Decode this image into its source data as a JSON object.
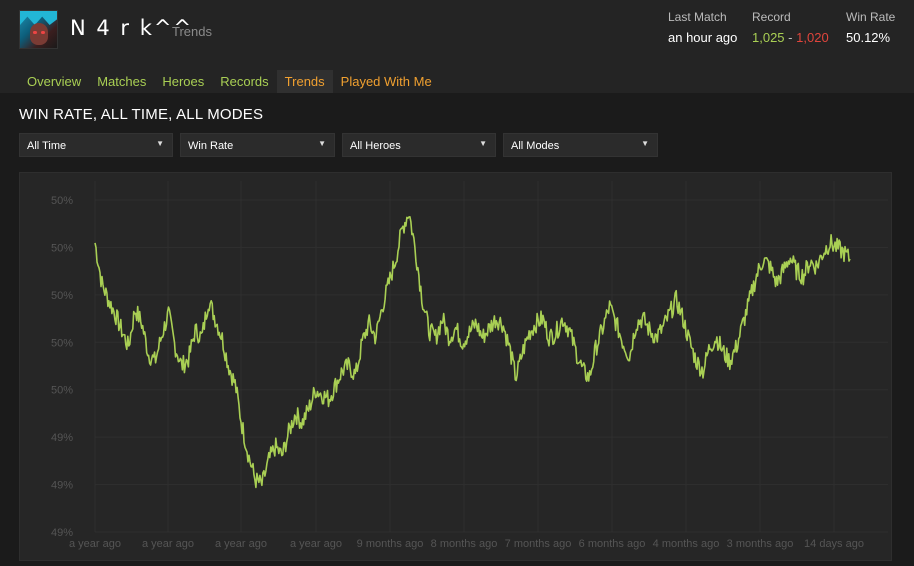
{
  "header": {
    "player_name": "N 4 r k^^",
    "page_subtitle": "Trends",
    "stats": {
      "last_match_label": "Last Match",
      "last_match_value": "an hour ago",
      "record_label": "Record",
      "record_wins": "1,025",
      "record_separator": "-",
      "record_losses": "1,020",
      "win_rate_label": "Win Rate",
      "win_rate_value": "50.12%"
    }
  },
  "tabs": [
    {
      "label": "Overview"
    },
    {
      "label": "Matches"
    },
    {
      "label": "Heroes"
    },
    {
      "label": "Records"
    },
    {
      "label": "Trends"
    },
    {
      "label": "Played With Me"
    }
  ],
  "section_title": "WIN RATE, ALL TIME, ALL MODES",
  "filters": [
    {
      "selected": "All Time"
    },
    {
      "selected": "Win Rate"
    },
    {
      "selected": "All Heroes"
    },
    {
      "selected": "All Modes"
    }
  ],
  "colors": {
    "accent_green": "#a9cf54",
    "accent_orange": "#f0a030",
    "loss_red": "#e0453c",
    "line": "#a9cf54"
  },
  "icons": {
    "dropdown": "caret-down-icon"
  },
  "chart_data": {
    "type": "line",
    "title": "",
    "xlabel": "",
    "ylabel": "",
    "y_tick_labels": [
      "50%",
      "50%",
      "50%",
      "50%",
      "50%",
      "49%",
      "49%",
      "49%"
    ],
    "x_tick_labels": [
      "a year ago",
      "a year ago",
      "a year ago",
      "a year ago",
      "9 months ago",
      "8 months ago",
      "7 months ago",
      "6 months ago",
      "4 months ago",
      "3 months ago",
      "14 days ago"
    ],
    "ylim": [
      49.2,
      50.6
    ],
    "grid": true,
    "series": [
      {
        "values": [
          50.42,
          50.25,
          50.18,
          50.12,
          50.05,
          49.98,
          50.14,
          50.08,
          49.95,
          49.92,
          50.03,
          50.12,
          49.98,
          49.9,
          49.93,
          50.05,
          50.02,
          50.18,
          50.1,
          50.02,
          49.9,
          49.82,
          49.65,
          49.52,
          49.42,
          49.4,
          49.5,
          49.56,
          49.52,
          49.62,
          49.7,
          49.66,
          49.72,
          49.8,
          49.78,
          49.76,
          49.82,
          49.88,
          49.9,
          49.86,
          50.0,
          50.08,
          50.02,
          50.15,
          50.25,
          50.35,
          50.48,
          50.55,
          50.38,
          50.18,
          50.05,
          50.02,
          50.1,
          50.02,
          50.06,
          50.0,
          50.04,
          50.08,
          50.02,
          50.06,
          50.1,
          50.08,
          49.98,
          49.85,
          49.96,
          50.04,
          50.08,
          50.1,
          50.02,
          50.04,
          50.1,
          50.05,
          49.96,
          49.88,
          49.85,
          49.98,
          50.06,
          50.15,
          50.08,
          50.0,
          49.94,
          50.08,
          50.1,
          50.05,
          50.02,
          50.06,
          50.12,
          50.18,
          50.1,
          50.0,
          49.92,
          49.88,
          49.98,
          50.02,
          49.96,
          49.92,
          49.98,
          50.08,
          50.18,
          50.28,
          50.35,
          50.32,
          50.25,
          50.3,
          50.36,
          50.3,
          50.28,
          50.34,
          50.32,
          50.38,
          50.42,
          50.4,
          50.38,
          50.35
        ]
      }
    ]
  }
}
